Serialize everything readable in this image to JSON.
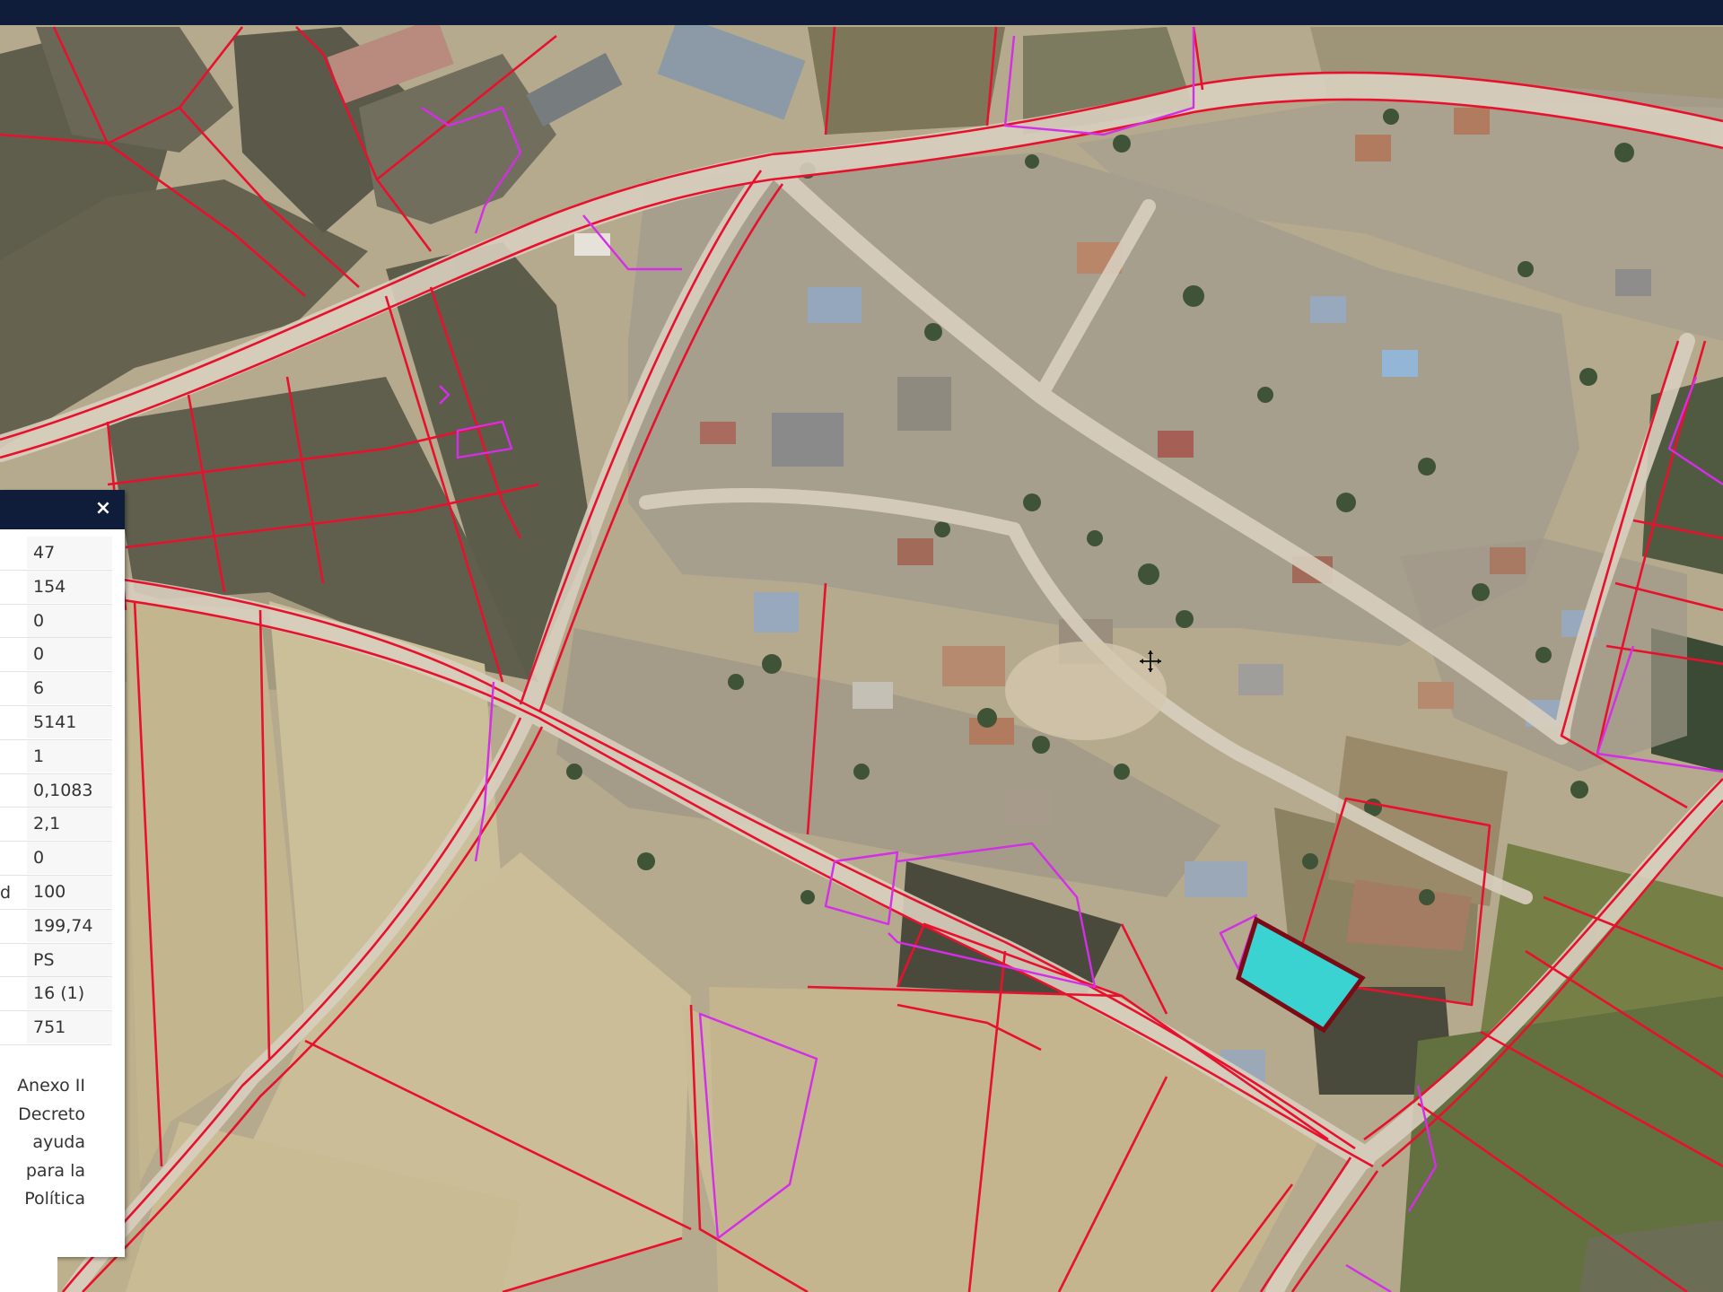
{
  "window": {
    "title_bar": ""
  },
  "info_panel": {
    "close_label": "×",
    "rows": [
      {
        "label": "",
        "value": "47"
      },
      {
        "label": "",
        "value": "154"
      },
      {
        "label": "",
        "value": "0"
      },
      {
        "label": "",
        "value": "0"
      },
      {
        "label": "",
        "value": "6"
      },
      {
        "label": "",
        "value": "5141"
      },
      {
        "label": "",
        "value": "1"
      },
      {
        "label": "",
        "value": "0,1083"
      },
      {
        "label": "",
        "value": "2,1"
      },
      {
        "label": "",
        "value": "0"
      },
      {
        "label": "d",
        "value": "100"
      },
      {
        "label": "",
        "value": "199,74"
      },
      {
        "label": "",
        "value": "PS"
      },
      {
        "label": "",
        "value": "16 (1)"
      },
      {
        "label": "",
        "value": "751"
      }
    ],
    "notes": [
      "Anexo  II",
      "Decreto",
      "ayuda",
      "para    la",
      "Política"
    ]
  },
  "map": {
    "type": "aerial-orthophoto",
    "parcel_line_color": "#e8112d",
    "enclosure_line_color": "#d42ee6",
    "selected_parcel_color": "#3ad3d1",
    "selected_parcel_outline": "#7a0a14",
    "cursor_icon": "crosshair-icon"
  }
}
